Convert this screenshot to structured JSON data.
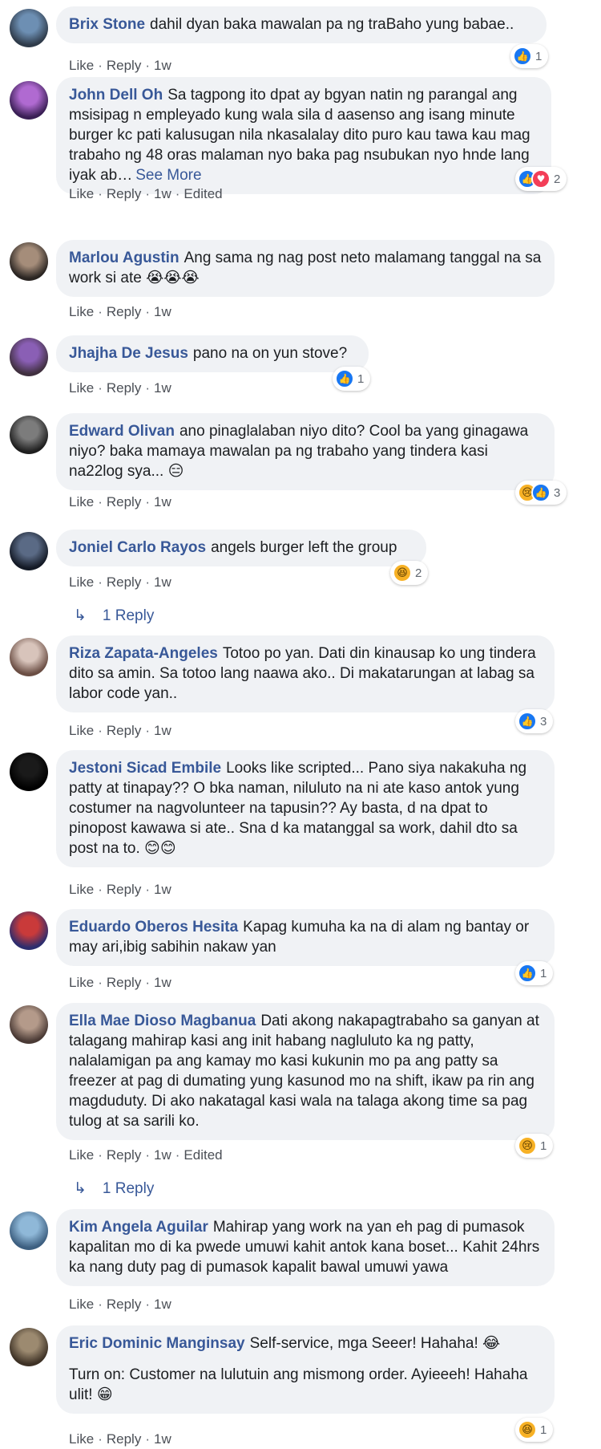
{
  "actions": {
    "like": "Like",
    "reply": "Reply",
    "sep": "·",
    "edited": "Edited"
  },
  "comments": [
    {
      "author": "Brix Stone",
      "text": "dahil dyan baka mawalan pa ng traBaho yung babae..",
      "time": "1w",
      "reactions": [
        "like"
      ],
      "reaction_count": "1",
      "avatar_colors": [
        "#6d8fb3",
        "#2f3b4a"
      ]
    },
    {
      "author": "John Dell Oh",
      "text": "Sa tagpong ito dpat ay bgyan natin ng parangal ang msisipag n empleyado kung wala sila d aasenso ang isang minute burger kc pati kalusugan nila nkasalalay dito puro kau tawa kau mag trabaho ng 48 oras malaman nyo baka pag nsubukan nyo hnde lang iyak ab…",
      "see_more": "See More",
      "time": "1w",
      "edited": true,
      "reactions": [
        "like",
        "love"
      ],
      "reaction_count": "2",
      "avatar_colors": [
        "#b06ad1",
        "#3a1f55"
      ]
    },
    {
      "author": "Marlou Agustin",
      "text": "Ang sama ng nag post neto malamang tanggal na sa work si ate",
      "emoji": "😭😭😭",
      "time": "1w",
      "avatar_colors": [
        "#a58d7a",
        "#2a2522"
      ]
    },
    {
      "author": "Jhajha De Jesus",
      "text": "pano na on yun stove?",
      "time": "1w",
      "reactions": [
        "like"
      ],
      "reaction_count": "1",
      "avatar_colors": [
        "#8a5fb5",
        "#40303f"
      ]
    },
    {
      "author": "Edward Olivan",
      "text": "ano pinaglalaban niyo dito? Cool ba yang ginagawa niyo? baka mamaya mawalan pa ng trabaho yang tindera kasi na22log sya...",
      "emoji": "😑",
      "time": "1w",
      "reactions": [
        "sad",
        "like"
      ],
      "reaction_count": "3",
      "avatar_colors": [
        "#7c7c7c",
        "#1f1f1f"
      ]
    },
    {
      "author": "Joniel Carlo Rayos",
      "text": "angels burger left the group",
      "time": "1w",
      "reactions": [
        "haha"
      ],
      "reaction_count": "2",
      "replies": "1 Reply",
      "avatar_colors": [
        "#5a6a85",
        "#141a26"
      ]
    },
    {
      "author": "Riza Zapata-Angeles",
      "text": "Totoo po yan. Dati din kinausap ko ung tindera dito sa amin. Sa totoo lang naawa ako.. Di makatarungan at labag sa labor code yan..",
      "time": "1w",
      "reactions": [
        "like"
      ],
      "reaction_count": "3",
      "avatar_colors": [
        "#d8c4bb",
        "#6b4e44"
      ]
    },
    {
      "author": "Jestoni Sicad Embile",
      "text": "Looks like scripted... Pano siya nakakuha ng patty at tinapay?? O bka naman, niluluto na ni ate kaso antok yung costumer na nagvolunteer na tapusin?? Ay basta, d na dpat to pinopost kawawa si ate.. Sna d ka matanggal sa work, dahil dto sa post na to.",
      "emoji": "😊😊",
      "time": "1w",
      "avatar_colors": [
        "#1a1a1a",
        "#000000"
      ]
    },
    {
      "author": "Eduardo Oberos Hesita",
      "text": "Kapag kumuha ka na di alam ng bantay or may ari,ibig sabihin nakaw yan",
      "time": "1w",
      "reactions": [
        "like"
      ],
      "reaction_count": "1",
      "avatar_colors": [
        "#c93a3a",
        "#2d2d6e"
      ]
    },
    {
      "author": "Ella Mae Dioso Magbanua",
      "text": "Dati akong nakapagtrabaho sa ganyan at talagang mahirap kasi ang init habang nagluluto ka ng patty, nalalamigan pa ang kamay mo kasi kukunin mo pa ang patty sa freezer at pag di dumating yung kasunod mo na shift, ikaw pa rin ang magduduty. Di ako nakatagal kasi wala na talaga akong time sa pag tulog at sa sarili ko.",
      "time": "1w",
      "edited": true,
      "reactions": [
        "sad"
      ],
      "reaction_count": "1",
      "replies": "1 Reply",
      "avatar_colors": [
        "#b49a8a",
        "#4a3a35"
      ]
    },
    {
      "author": "Kim Angela Aguilar",
      "text": "Mahirap yang work na yan eh pag di pumasok kapalitan mo di ka pwede umuwi kahit antok kana boset... Kahit 24hrs ka nang duty pag di pumasok kapalit bawal umuwi yawa",
      "time": "1w",
      "avatar_colors": [
        "#8fb8d8",
        "#3d5f80"
      ]
    },
    {
      "author": "Eric Dominic Manginsay",
      "text": "Self-service, mga Seeer! Hahaha!",
      "emoji": "😂",
      "text2": "Turn on: Customer na lulutuin ang mismong order. Ayieeeh! Hahaha ulit!",
      "emoji2": "😁",
      "time": "1w",
      "reactions": [
        "haha"
      ],
      "reaction_count": "1",
      "avatar_colors": [
        "#9c8a70",
        "#3e3226"
      ]
    }
  ]
}
